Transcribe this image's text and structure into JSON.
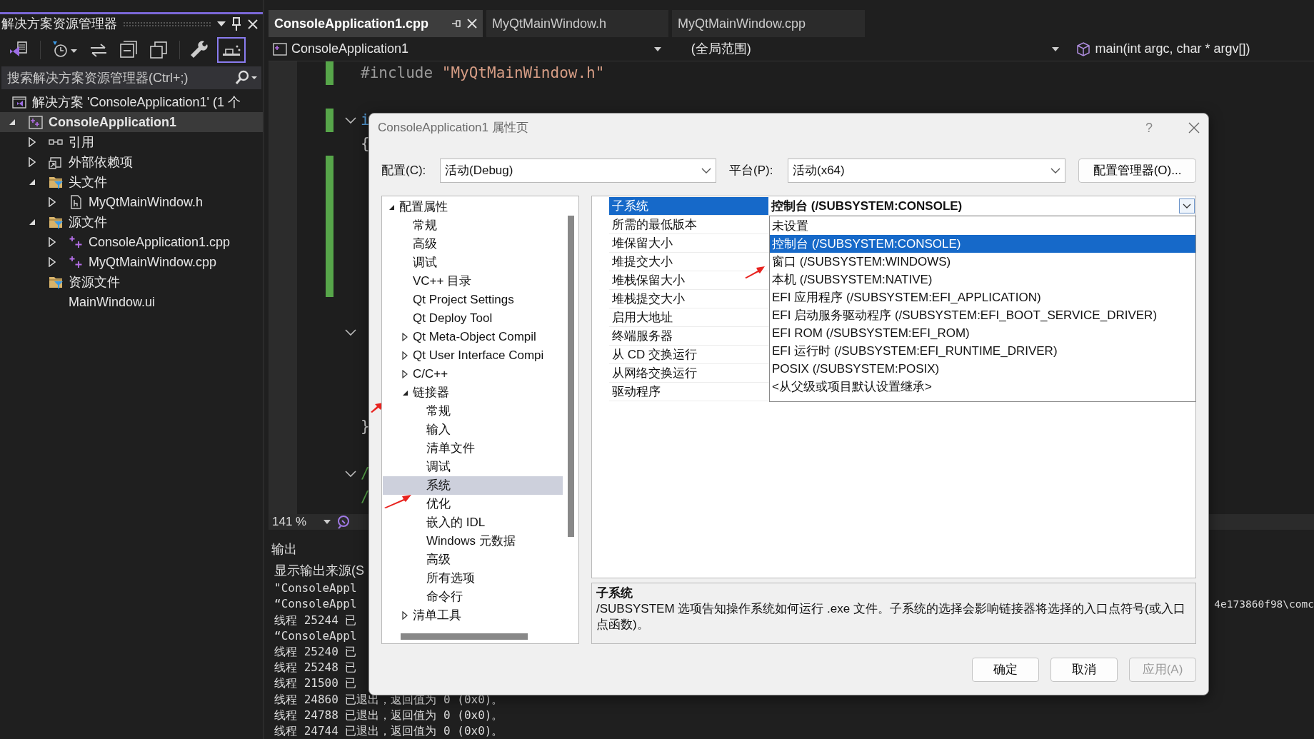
{
  "solution_explorer": {
    "title": "解决方案资源管理器",
    "toolbar_groups": [
      [
        {
          "kind": "switch",
          "selected": false
        }
      ],
      [
        {
          "kind": "history",
          "selected": false
        },
        {
          "kind": "sync",
          "selected": false
        },
        {
          "kind": "collapse",
          "selected": false
        },
        {
          "kind": "copy",
          "selected": false
        }
      ],
      [
        {
          "kind": "wrench",
          "selected": false
        },
        {
          "kind": "preview",
          "selected": true
        }
      ]
    ],
    "search": {
      "placeholder": "搜索解决方案资源管理器(Ctrl+;)"
    },
    "tree": [
      {
        "label": "解决方案 'ConsoleApplication1' (1 个",
        "kind": "solution",
        "selected": false,
        "children": [
          {
            "label": "ConsoleApplication1",
            "kind": "project",
            "expanded": true,
            "selected": true,
            "children": [
              {
                "label": "引用",
                "kind": "references",
                "expanded": false,
                "selected": false
              },
              {
                "label": "外部依赖项",
                "kind": "external",
                "expanded": false,
                "selected": false
              },
              {
                "label": "头文件",
                "kind": "filter",
                "expanded": true,
                "selected": false,
                "children": [
                  {
                    "label": "MyQtMainWindow.h",
                    "kind": "header",
                    "expanded": false,
                    "selected": false
                  }
                ]
              },
              {
                "label": "源文件",
                "kind": "filter",
                "expanded": true,
                "selected": false,
                "children": [
                  {
                    "label": "ConsoleApplication1.cpp",
                    "kind": "cpp",
                    "expanded": false,
                    "selected": false
                  },
                  {
                    "label": "MyQtMainWindow.cpp",
                    "kind": "cpp",
                    "expanded": false,
                    "selected": false
                  }
                ]
              },
              {
                "label": "资源文件",
                "kind": "filter",
                "selected": false,
                "children": [
                  {
                    "label": "MainWindow.ui",
                    "kind": "plain",
                    "selected": false
                  }
                ]
              }
            ]
          }
        ]
      }
    ]
  },
  "editor": {
    "tabs": [
      {
        "label": "ConsoleApplication1.cpp",
        "selected": true
      },
      {
        "label": "MyQtMainWindow.h",
        "selected": false
      },
      {
        "label": "MyQtMainWindow.cpp",
        "selected": false
      }
    ],
    "nav": [
      {
        "kind": "project",
        "text": "ConsoleApplication1"
      },
      {
        "kind": "scope",
        "text": "(全局范围)"
      },
      {
        "kind": "member",
        "text": "main(int argc, char * argv[])"
      }
    ],
    "code": [
      {
        "kind": "code",
        "changed": true,
        "fold": false,
        "segments": [
          {
            "kind": "directive",
            "text": "#include "
          },
          {
            "kind": "string",
            "text": "\"MyQtMainWindow.h\""
          }
        ]
      },
      {
        "kind": "blank",
        "changed": false,
        "fold": false
      },
      {
        "kind": "code",
        "changed": true,
        "fold": true,
        "segments": [
          {
            "kind": "keyword",
            "text": "i"
          }
        ]
      },
      {
        "kind": "code",
        "changed": false,
        "fold": false,
        "segments": [
          {
            "kind": "punct",
            "text": "{"
          }
        ]
      },
      {
        "kind": "blank",
        "changed": true,
        "fold": false
      },
      {
        "kind": "blank",
        "changed": true,
        "fold": false
      },
      {
        "kind": "blank",
        "changed": true,
        "fold": false
      },
      {
        "kind": "blank",
        "changed": true,
        "fold": false
      },
      {
        "kind": "blank",
        "changed": true,
        "fold": false
      },
      {
        "kind": "blank",
        "changed": true,
        "fold": false
      },
      {
        "kind": "blank",
        "changed": false,
        "fold": false
      },
      {
        "kind": "blank",
        "changed": false,
        "fold": true
      },
      {
        "kind": "blank",
        "changed": false,
        "fold": false
      },
      {
        "kind": "blank",
        "changed": false,
        "fold": false
      },
      {
        "kind": "blank",
        "changed": false,
        "fold": false
      },
      {
        "kind": "code",
        "changed": false,
        "fold": false,
        "segments": [
          {
            "kind": "punct",
            "text": "}"
          }
        ]
      },
      {
        "kind": "blank",
        "changed": false,
        "fold": false
      },
      {
        "kind": "code",
        "changed": false,
        "fold": true,
        "segments": [
          {
            "kind": "comment",
            "text": "/"
          }
        ]
      },
      {
        "kind": "code",
        "changed": false,
        "fold": false,
        "segments": [
          {
            "kind": "comment",
            "text": "/"
          }
        ]
      }
    ],
    "zoom": "141 %"
  },
  "output": {
    "title": "输出",
    "source_label": "显示输出来源(S",
    "lines": [
      {
        "text": "\"ConsoleAppl"
      },
      {
        "text": "“ConsoleAppl",
        "tail": "4e173860f98\\comc"
      },
      {
        "text": "线程 25244 已"
      },
      {
        "text": "“ConsoleAppl"
      },
      {
        "text": "线程 25240 已"
      },
      {
        "text": "线程 25248 已"
      },
      {
        "text": "线程 21500 已"
      },
      {
        "text": "线程 24860 已退出，返回值为 0 (0x0)。"
      },
      {
        "text": "线程 24788 已退出，返回值为 0 (0x0)。"
      },
      {
        "text": "线程 24744 已退出，返回值为 0 (0x0)。"
      }
    ]
  },
  "dialog": {
    "title": "ConsoleApplication1 属性页",
    "help": "?",
    "configuration": {
      "label": "配置(C):",
      "value": "活动(Debug)"
    },
    "platform": {
      "label": "平台(P):",
      "value": "活动(x64)"
    },
    "manager_button": "配置管理器(O)...",
    "tree": [
      {
        "label": "配置属性",
        "expanded": true,
        "selected": false,
        "children": [
          {
            "label": "常规",
            "selected": false
          },
          {
            "label": "高级",
            "selected": false
          },
          {
            "label": "调试",
            "selected": false
          },
          {
            "label": "VC++ 目录",
            "selected": false
          },
          {
            "label": "Qt Project Settings",
            "selected": false
          },
          {
            "label": "Qt Deploy Tool",
            "selected": false
          },
          {
            "label": "Qt Meta-Object Compil",
            "expanded": false,
            "selected": false
          },
          {
            "label": "Qt User Interface Compi",
            "expanded": false,
            "selected": false
          },
          {
            "label": "C/C++",
            "expanded": false,
            "selected": false
          },
          {
            "label": "链接器",
            "expanded": true,
            "selected": false,
            "children": [
              {
                "label": "常规",
                "selected": false
              },
              {
                "label": "输入",
                "selected": false
              },
              {
                "label": "清单文件",
                "selected": false
              },
              {
                "label": "调试",
                "selected": false
              },
              {
                "label": "系统",
                "selected": true
              },
              {
                "label": "优化",
                "selected": false
              },
              {
                "label": "嵌入的 IDL",
                "selected": false
              },
              {
                "label": "Windows 元数据",
                "selected": false
              },
              {
                "label": "高级",
                "selected": false
              },
              {
                "label": "所有选项",
                "selected": false
              },
              {
                "label": "命令行",
                "selected": false
              }
            ]
          },
          {
            "label": "清单工具",
            "expanded": false,
            "selected": false
          }
        ]
      }
    ],
    "properties": [
      {
        "label": "子系统",
        "value": "控制台 (/SUBSYSTEM:CONSOLE)",
        "selected": true
      },
      {
        "label": "所需的最低版本",
        "selected": false
      },
      {
        "label": "堆保留大小",
        "selected": false
      },
      {
        "label": "堆提交大小",
        "selected": false
      },
      {
        "label": "堆栈保留大小",
        "selected": false
      },
      {
        "label": "堆栈提交大小",
        "selected": false
      },
      {
        "label": "启用大地址",
        "selected": false
      },
      {
        "label": "终端服务器",
        "selected": false
      },
      {
        "label": "从 CD 交换运行",
        "selected": false
      },
      {
        "label": "从网络交换运行",
        "selected": false
      },
      {
        "label": "驱动程序",
        "selected": false
      }
    ],
    "dropdown": {
      "options": [
        {
          "label": "未设置",
          "selected": false
        },
        {
          "label": "控制台 (/SUBSYSTEM:CONSOLE)",
          "selected": true
        },
        {
          "label": "窗口 (/SUBSYSTEM:WINDOWS)",
          "selected": false
        },
        {
          "label": "本机 (/SUBSYSTEM:NATIVE)",
          "selected": false
        },
        {
          "label": "EFI 应用程序 (/SUBSYSTEM:EFI_APPLICATION)",
          "selected": false
        },
        {
          "label": "EFI 启动服务驱动程序 (/SUBSYSTEM:EFI_BOOT_SERVICE_DRIVER)",
          "selected": false
        },
        {
          "label": "EFI ROM (/SUBSYSTEM:EFI_ROM)",
          "selected": false
        },
        {
          "label": "EFI 运行时 (/SUBSYSTEM:EFI_RUNTIME_DRIVER)",
          "selected": false
        },
        {
          "label": "POSIX (/SUBSYSTEM:POSIX)",
          "selected": false
        },
        {
          "label": "<从父级或项目默认设置继承>",
          "selected": false
        }
      ]
    },
    "description": {
      "title": "子系统",
      "text": "/SUBSYSTEM 选项告知操作系统如何运行 .exe 文件。子系统的选择会影响链接器将选择的入口点符号(或入口点函数)。"
    },
    "buttons": [
      {
        "label": "确定",
        "disabled": false
      },
      {
        "label": "取消",
        "disabled": false
      },
      {
        "label": "应用(A)",
        "disabled": true
      }
    ]
  }
}
